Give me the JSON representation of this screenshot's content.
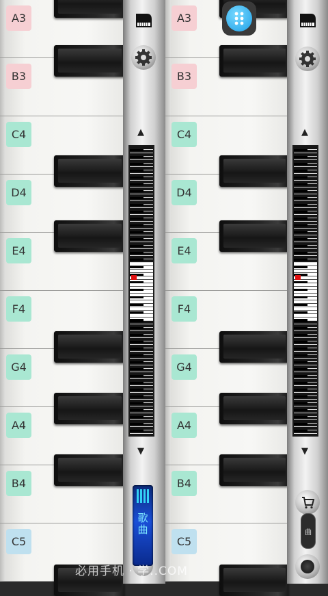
{
  "keys": [
    {
      "note": "A3",
      "color": "#f6cfd3"
    },
    {
      "note": "B3",
      "color": "#f6cfd3"
    },
    {
      "note": "C4",
      "color": "#a9e7d2"
    },
    {
      "note": "D4",
      "color": "#a9e7d2"
    },
    {
      "note": "E4",
      "color": "#a9e7d2"
    },
    {
      "note": "F4",
      "color": "#a9e7d2"
    },
    {
      "note": "G4",
      "color": "#a9e7d2"
    },
    {
      "note": "A4",
      "color": "#a9e7d2"
    },
    {
      "note": "B4",
      "color": "#a9e7d2"
    },
    {
      "note": "C5",
      "color": "#bfe0ef"
    }
  ],
  "controls": {
    "scroll_up": "▲",
    "scroll_down": "▼",
    "songs_label": "歌曲",
    "small_toggle_label": "曲"
  },
  "watermark": "必用手机 · 学..COM"
}
